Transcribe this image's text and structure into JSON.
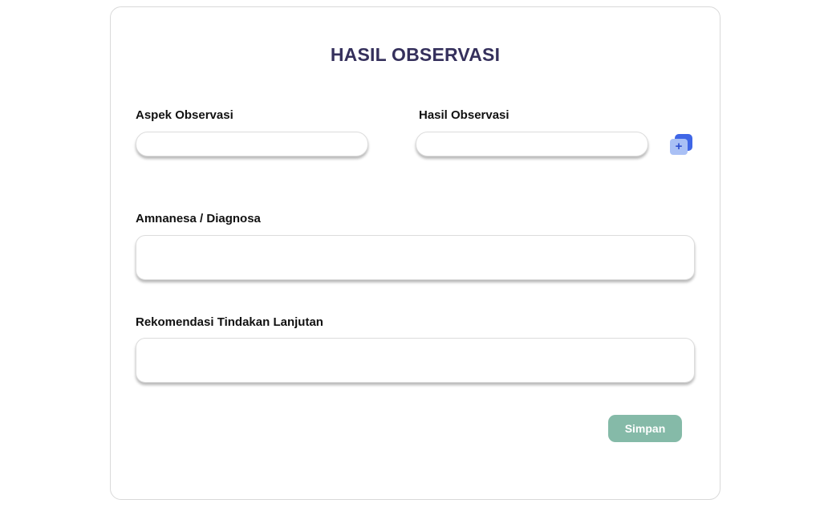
{
  "form": {
    "title": "HASIL OBSERVASI",
    "fields": {
      "aspek": {
        "label": "Aspek Observasi",
        "value": "",
        "placeholder": ""
      },
      "hasil": {
        "label": "Hasil Observasi",
        "value": "",
        "placeholder": ""
      },
      "amnanesa": {
        "label": "Amnanesa / Diagnosa",
        "value": "",
        "placeholder": ""
      },
      "rekomendasi": {
        "label": "Rekomendasi Tindakan Lanjutan",
        "value": "",
        "placeholder": ""
      }
    },
    "add_icon": {
      "name": "add-files-icon",
      "glyph": "+",
      "colors": {
        "front": "#a9c0f5",
        "back": "#3f66e6"
      }
    },
    "save_label": "Simpan",
    "colors": {
      "title": "#35305c",
      "save_button": "#85baa8"
    }
  }
}
